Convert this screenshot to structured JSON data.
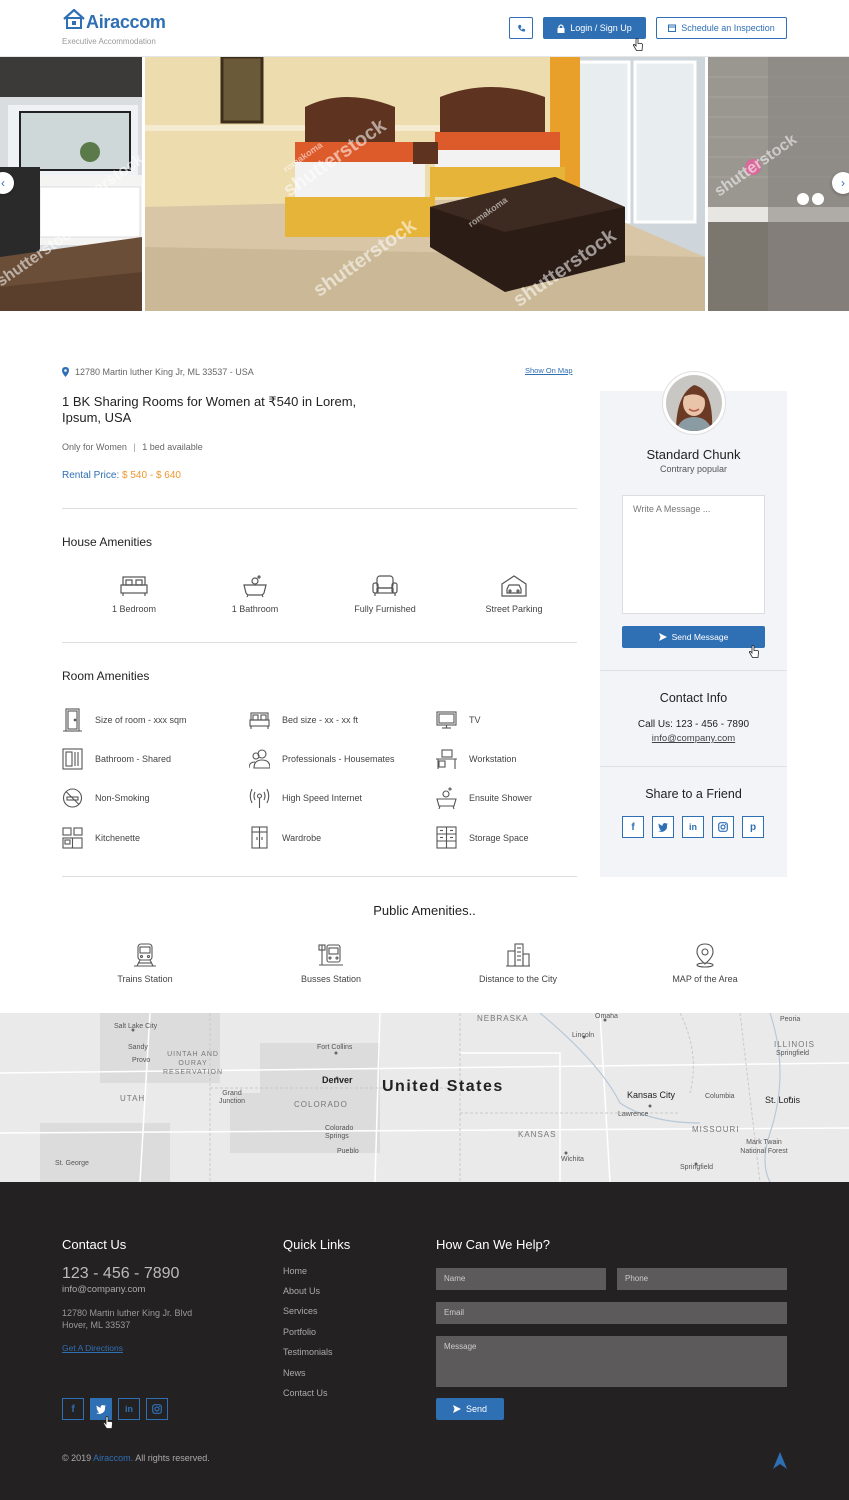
{
  "header": {
    "logo_text": "Airaccom",
    "logo_subtitle": "Executive Accommodation",
    "login_label": "Login / Sign Up",
    "schedule_label": "Schedule an Inspection",
    "accent_color": "#2f6fb4"
  },
  "gallery": {
    "watermark": "shutterstock",
    "watermark_author": "romakoma"
  },
  "listing": {
    "address": "12780 Martin luther King Jr, ML 33537 - USA",
    "show_on_map": "Show On Map",
    "title_line1": "1 BK Sharing Rooms for Women at ₹540 in Lorem,",
    "title_line2": "Ipsum, USA",
    "meta1": "Only for Women",
    "meta2": "1 bed available",
    "price_label": "Rental Price:",
    "price_value": "$ 540 - $ 640",
    "price_color": "#f0962e"
  },
  "house_amenities": {
    "title": "House Amenities",
    "items": [
      {
        "label": "1 Bedroom",
        "icon": "bed-icon"
      },
      {
        "label": "1 Bathroom",
        "icon": "bathtub-icon"
      },
      {
        "label": "Fully Furnished",
        "icon": "armchair-icon"
      },
      {
        "label": "Street Parking",
        "icon": "garage-icon"
      }
    ]
  },
  "room_amenities": {
    "title": "Room Amenities",
    "items": [
      {
        "label": "Size of room - xxx sqm",
        "icon": "door-icon"
      },
      {
        "label": "Bed size - xx - xx ft",
        "icon": "bed-icon"
      },
      {
        "label": "TV",
        "icon": "tv-icon"
      },
      {
        "label": "Bathroom - Shared",
        "icon": "bathroom-icon"
      },
      {
        "label": "Professionals - Housemates",
        "icon": "people-icon"
      },
      {
        "label": "Workstation",
        "icon": "desk-icon"
      },
      {
        "label": "Non-Smoking",
        "icon": "no-smoking-icon"
      },
      {
        "label": "High Speed Internet",
        "icon": "wifi-icon"
      },
      {
        "label": "Ensuite Shower",
        "icon": "shower-icon"
      },
      {
        "label": "Kitchenette",
        "icon": "kitchen-icon"
      },
      {
        "label": "Wardrobe",
        "icon": "wardrobe-icon"
      },
      {
        "label": "Storage Space",
        "icon": "storage-icon"
      }
    ]
  },
  "public_amenities": {
    "title": "Public Amenities..",
    "items": [
      {
        "label": "Trains Station",
        "icon": "train-icon"
      },
      {
        "label": "Busses Station",
        "icon": "bus-icon"
      },
      {
        "label": "Distance to the City",
        "icon": "city-icon"
      },
      {
        "label": "MAP of the Area",
        "icon": "map-pin-icon"
      }
    ]
  },
  "agent": {
    "name": "Standard Chunk",
    "role": "Contrary popular",
    "message_placeholder": "Write A Message ...",
    "send_label": "Send Message",
    "contact_title": "Contact Info",
    "phone": "Call Us: 123 - 456 - 7890",
    "email": "info@company.com",
    "share_title": "Share to a Friend",
    "share_icons": [
      "f",
      "t",
      "in",
      "ig",
      "p"
    ]
  },
  "map": {
    "country": "United States",
    "states": [
      "NEBRASKA",
      "ILLINOIS",
      "UTAH",
      "COLORADO",
      "KANSAS",
      "MISSOURI",
      "UINTAH AND OURAY RESERVATION"
    ],
    "cities": [
      "Salt Lake City",
      "Sandy",
      "Provo",
      "Fort Collins",
      "Denver",
      "Grand Junction",
      "Colorado Springs",
      "Pueblo",
      "Omaha",
      "Lincoln",
      "Kansas City",
      "Lawrence",
      "Columbia",
      "St. Louis",
      "Peoria",
      "Springfield",
      "Mark Twain National Forest",
      "Wichita",
      "St. George"
    ]
  },
  "footer": {
    "contact_title": "Contact Us",
    "phone": "123 - 456 - 7890",
    "email": "info@company.com",
    "address_line1": "12780 Martin luther King Jr. Blvd",
    "address_line2": "Hover, ML 33537",
    "directions": "Get A Directions",
    "quick_links_title": "Quick Links",
    "links": [
      "Home",
      "About Us",
      "Services",
      "Portfolio",
      "Testimonials",
      "News",
      "Contact Us"
    ],
    "help_title": "How Can We Help?",
    "name_placeholder": "Name",
    "phone_placeholder": "Phone",
    "email_placeholder": "Email",
    "message_placeholder": "Message",
    "send_label": "Send",
    "copyright_prefix": "© 2019",
    "copyright_brand": "Airaccom.",
    "copyright_suffix": "All rights reserved."
  }
}
